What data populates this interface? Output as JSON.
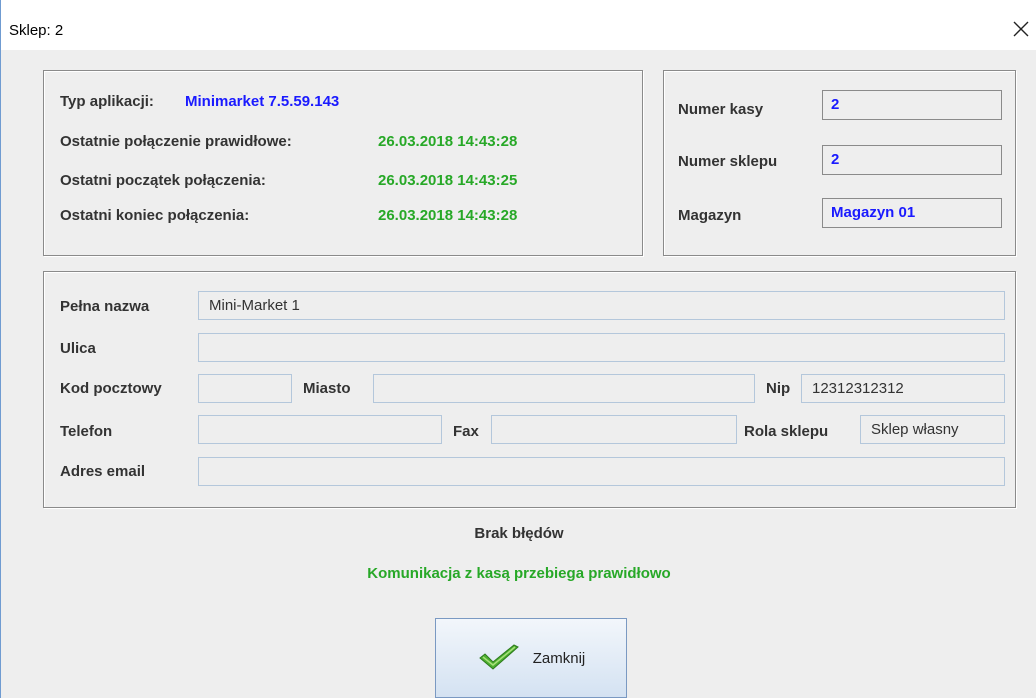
{
  "window": {
    "title": "Sklep: 2"
  },
  "info": {
    "app_type_label": "Typ aplikacji:",
    "app_type_value": "Minimarket  7.5.59.143",
    "last_ok_label": "Ostatnie połączenie prawidłowe:",
    "last_ok_value": "26.03.2018 14:43:28",
    "last_start_label": "Ostatni początek połączenia:",
    "last_start_value": "26.03.2018 14:43:25",
    "last_end_label": "Ostatni koniec połączenia:",
    "last_end_value": "26.03.2018 14:43:28"
  },
  "register": {
    "till_label": "Numer kasy",
    "till_value": "2",
    "shop_label": "Numer sklepu",
    "shop_value": "2",
    "warehouse_label": "Magazyn",
    "warehouse_value": "Magazyn 01"
  },
  "shop": {
    "full_name_label": "Pełna nazwa",
    "full_name_value": "Mini-Market 1",
    "street_label": "Ulica",
    "street_value": "",
    "postal_label": "Kod pocztowy",
    "postal_value": "",
    "city_label": "Miasto",
    "city_value": "",
    "nip_label": "Nip",
    "nip_value": "12312312312",
    "phone_label": "Telefon",
    "phone_value": "",
    "fax_label": "Fax",
    "fax_value": "",
    "role_label": "Rola sklepu",
    "role_value": "Sklep własny",
    "email_label": "Adres email",
    "email_value": ""
  },
  "status": {
    "errors": "Brak błędów",
    "communication": "Komunikacja z kasą przebiega prawidłowo"
  },
  "buttons": {
    "close_label": "Zamknij"
  },
  "colors": {
    "blue_value": "#1a1aff",
    "green_value": "#27a827"
  },
  "icons": {
    "close": "close-icon",
    "check": "checkmark-icon"
  }
}
